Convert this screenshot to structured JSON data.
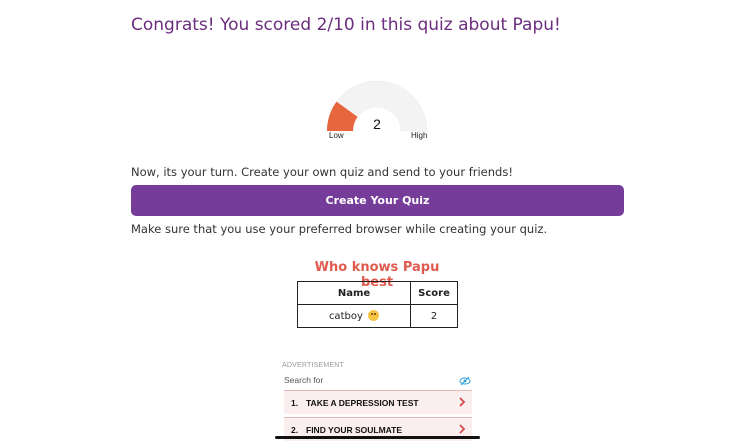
{
  "result": {
    "title": "Congrats! You scored 2/10 in this quiz about Papu!",
    "score": 2,
    "max_score": 10,
    "gauge": {
      "value": "2",
      "low_label": "Low",
      "high_label": "High",
      "fill_color": "#e8663d"
    }
  },
  "cta": {
    "prompt": "Now, its your turn. Create your own quiz and send to your friends!",
    "button_label": "Create Your Quiz",
    "note": "Make sure that you use your preferred browser while creating your quiz.",
    "button_color": "#763c99"
  },
  "leaderboard": {
    "title": "Who knows Papu best",
    "columns": [
      "Name",
      "Score"
    ],
    "rows": [
      {
        "name": "catboy",
        "emoji": "sad-face-emoji",
        "score": "2"
      }
    ]
  },
  "ad": {
    "label": "ADVERTISEMENT",
    "search_label": "Search for",
    "items": [
      {
        "num": "1.",
        "label": "TAKE A DEPRESSION TEST"
      },
      {
        "num": "2.",
        "label": "FIND YOUR SOULMATE"
      }
    ]
  },
  "colors": {
    "title": "#6b2d7e",
    "board_title": "#e05a4e",
    "ad_item_bg": "#fbeeee"
  }
}
